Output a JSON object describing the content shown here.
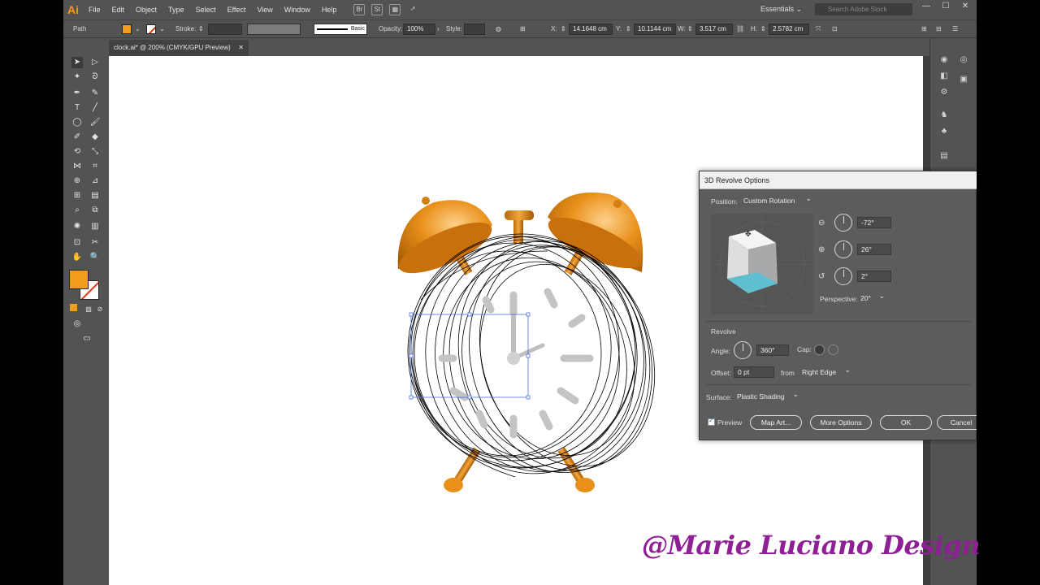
{
  "menubar": {
    "logo": "Ai",
    "items": [
      "File",
      "Edit",
      "Object",
      "Type",
      "Select",
      "Effect",
      "View",
      "Window",
      "Help"
    ],
    "workspace": "Essentials",
    "search_placeholder": "Search Adobe Stock"
  },
  "controlbar": {
    "selection_type": "Path",
    "stroke_label": "Stroke:",
    "brush": "Basic",
    "opacity_label": "Opacity:",
    "opacity": "100%",
    "style_label": "Style:",
    "x_label": "X:",
    "x": "14.1648 cm",
    "y_label": "Y:",
    "y": "10.1144 cm",
    "w_label": "W:",
    "w": "3.517 cm",
    "h_label": "H:",
    "h": "2.5782 cm"
  },
  "document": {
    "tab_title": "clock.ai* @ 200% (CMYK/GPU Preview)"
  },
  "colors": {
    "fill": "#f39c1d",
    "accent_orange": "#e8901a",
    "canvas": "#ffffff",
    "ui_bg": "#535353",
    "watermark": "#8e1f94"
  },
  "dialog": {
    "title": "3D Revolve Options",
    "position_label": "Position:",
    "position_value": "Custom Rotation",
    "rotate_x": "-72°",
    "rotate_y": "26°",
    "rotate_z": "2°",
    "perspective_label": "Perspective:",
    "perspective_value": "20°",
    "revolve_heading": "Revolve",
    "angle_label": "Angle:",
    "angle_value": "360°",
    "cap_label": "Cap:",
    "offset_label": "Offset:",
    "offset_value": "0 pt",
    "from_label": "from",
    "from_value": "Right Edge",
    "surface_label": "Surface:",
    "surface_value": "Plastic Shading",
    "preview_label": "Preview",
    "preview_checked": true,
    "map_art_label": "Map Art...",
    "more_options_label": "More Options",
    "ok_label": "OK",
    "cancel_label": "Cancel"
  },
  "watermark": "@Marie Luciano Design"
}
